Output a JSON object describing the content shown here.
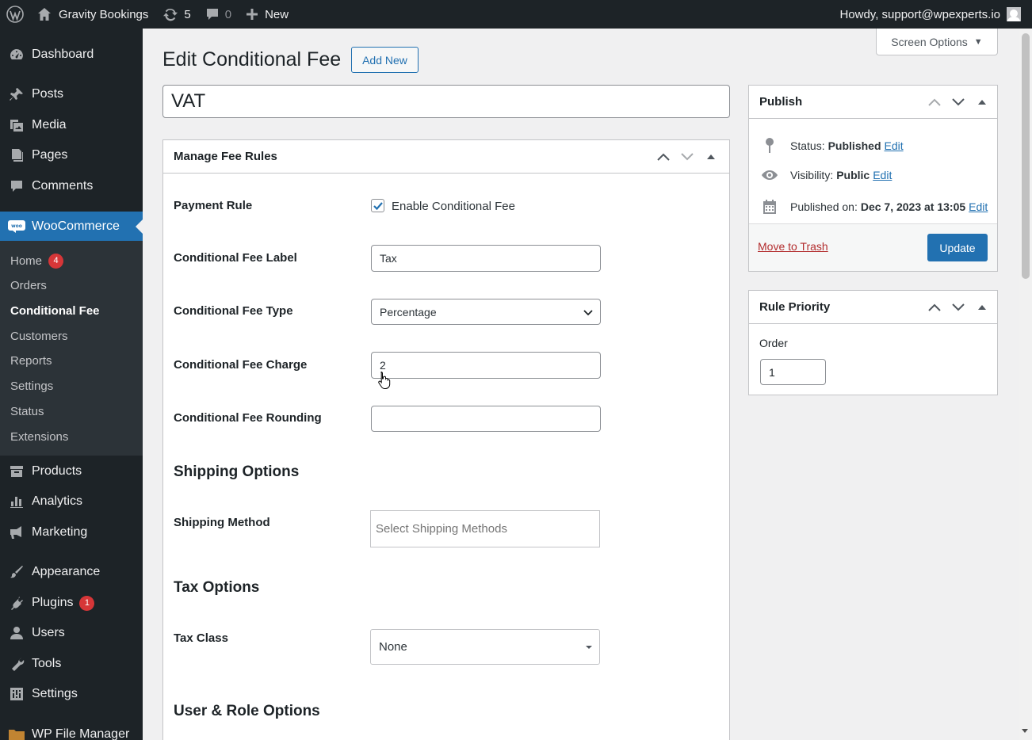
{
  "admin_bar": {
    "site_name": "Gravity Bookings",
    "updates_count": "5",
    "comments_count": "0",
    "new_label": "New",
    "howdy": "Howdy, support@wpexperts.io"
  },
  "sidebar": {
    "items": [
      {
        "label": "Dashboard",
        "icon": "dashboard-icon"
      },
      {
        "label": "Posts",
        "icon": "pushpin-icon"
      },
      {
        "label": "Media",
        "icon": "media-icon"
      },
      {
        "label": "Pages",
        "icon": "pages-icon"
      },
      {
        "label": "Comments",
        "icon": "comment-icon"
      },
      {
        "label": "WooCommerce",
        "icon": "woo-icon"
      },
      {
        "label": "Products",
        "icon": "archive-icon"
      },
      {
        "label": "Analytics",
        "icon": "bar-chart-icon"
      },
      {
        "label": "Marketing",
        "icon": "megaphone-icon"
      },
      {
        "label": "Appearance",
        "icon": "paintbrush-icon"
      },
      {
        "label": "Plugins",
        "icon": "plug-icon"
      },
      {
        "label": "Users",
        "icon": "users-icon"
      },
      {
        "label": "Tools",
        "icon": "wrench-icon"
      },
      {
        "label": "Settings",
        "icon": "settings-icon"
      },
      {
        "label": "WP File Manager",
        "icon": "folder-icon"
      }
    ],
    "plugins_badge": "1",
    "submenu": [
      {
        "label": "Home"
      },
      {
        "label": "Orders"
      },
      {
        "label": "Conditional Fee"
      },
      {
        "label": "Customers"
      },
      {
        "label": "Reports"
      },
      {
        "label": "Settings"
      },
      {
        "label": "Status"
      },
      {
        "label": "Extensions"
      }
    ],
    "home_badge": "4"
  },
  "screen_options": "Screen Options",
  "page": {
    "title": "Edit Conditional Fee",
    "add_new": "Add New",
    "post_title": "VAT"
  },
  "manage_fee_rules": {
    "header": "Manage Fee Rules",
    "payment_rule_label": "Payment Rule",
    "enable_label": "Enable Conditional Fee",
    "enabled": true,
    "fee_label_label": "Conditional Fee Label",
    "fee_label_value": "Tax",
    "fee_type_label": "Conditional Fee Type",
    "fee_type_value": "Percentage",
    "fee_charge_label": "Conditional Fee Charge",
    "fee_charge_value": "2",
    "fee_rounding_label": "Conditional Fee Rounding",
    "fee_rounding_value": "",
    "shipping_options_title": "Shipping Options",
    "shipping_method_label": "Shipping Method",
    "shipping_method_placeholder": "Select Shipping Methods",
    "tax_options_title": "Tax Options",
    "tax_class_label": "Tax Class",
    "tax_class_value": "None",
    "user_role_title": "User & Role Options"
  },
  "publish": {
    "header": "Publish",
    "status_label": "Status:",
    "status_value": "Published",
    "visibility_label": "Visibility:",
    "visibility_value": "Public",
    "published_label": "Published on:",
    "published_value": "Dec 7, 2023 at 13:05",
    "edit_label": "Edit",
    "trash_label": "Move to Trash",
    "update_label": "Update"
  },
  "rule_priority": {
    "header": "Rule Priority",
    "order_label": "Order",
    "order_value": "1"
  },
  "colors": {
    "admin_dark": "#1d2327",
    "accent": "#2271b1",
    "badge": "#d63638"
  }
}
